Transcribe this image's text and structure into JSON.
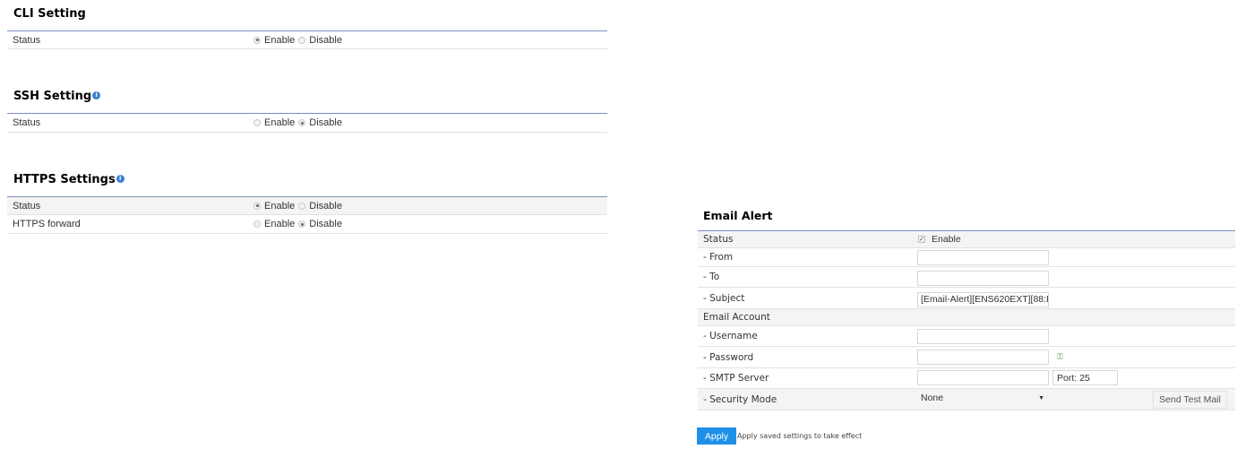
{
  "cli": {
    "title": "CLI Setting",
    "rows": [
      {
        "label": "Status",
        "enable": "Enable",
        "disable": "Disable",
        "selected": "enable"
      }
    ]
  },
  "ssh": {
    "title": "SSH Setting",
    "info_icon": "info-icon",
    "rows": [
      {
        "label": "Status",
        "enable": "Enable",
        "disable": "Disable",
        "selected": "disable"
      }
    ]
  },
  "https": {
    "title": "HTTPS Settings",
    "info_icon": "info-icon",
    "rows": [
      {
        "label": "Status",
        "enable": "Enable",
        "disable": "Disable",
        "selected": "enable"
      },
      {
        "label": "HTTPS forward",
        "enable": "Enable",
        "disable": "Disable",
        "selected": "disable"
      }
    ]
  },
  "email": {
    "title": "Email Alert",
    "status_label": "Status",
    "status_checkbox": "Enable",
    "status_checked": true,
    "from_label": "- From",
    "from_value": "",
    "to_label": "- To",
    "to_value": "",
    "subject_label": "- Subject",
    "subject_value": "[Email-Alert][ENS620EXT][88:D",
    "account_label": "Email Account",
    "username_label": "- Username",
    "username_value": "",
    "password_label": "- Password",
    "password_value": "",
    "password_icon": "key-icon",
    "smtp_label": "- SMTP Server",
    "smtp_value": "",
    "port_label": "Port:",
    "port_value": "25",
    "security_label": "- Security Mode",
    "security_value": "None",
    "send_test_label": "Send Test Mail"
  },
  "footer": {
    "apply_label": "Apply",
    "apply_note": "Apply saved settings to take effect"
  },
  "colors": {
    "accent": "#1e90e8",
    "rule": "#7b8fbf",
    "info": "#3a7fd0"
  }
}
